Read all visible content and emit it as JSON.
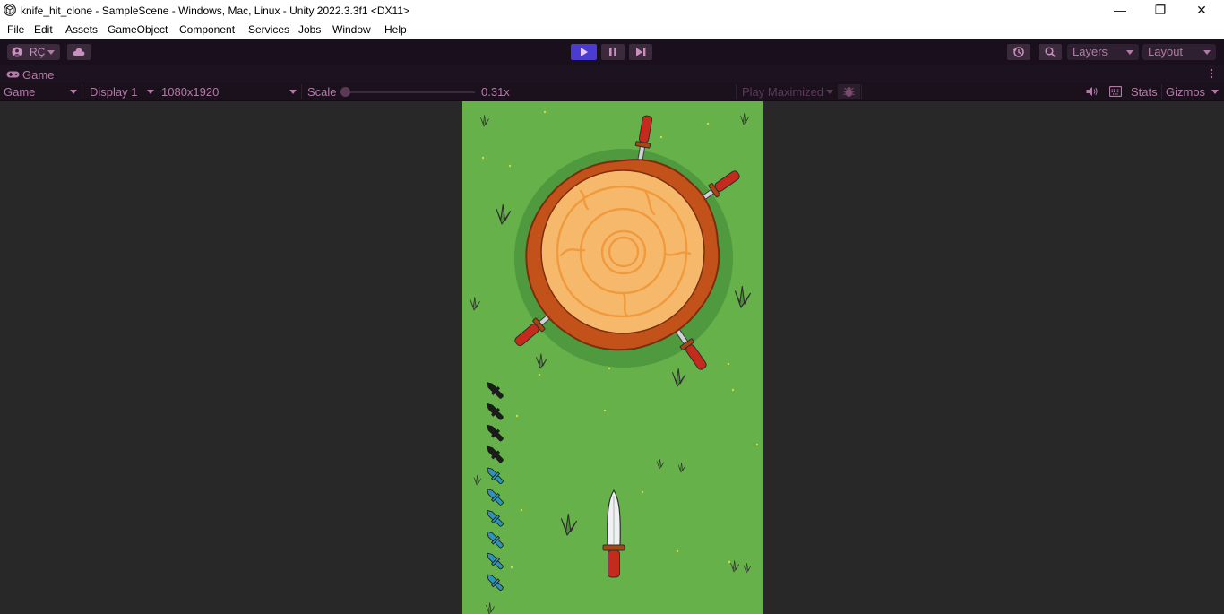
{
  "window": {
    "title": "knife_hit_clone - SampleScene - Windows, Mac, Linux - Unity 2022.3.3f1 <DX11>",
    "minimize_glyph": "—",
    "maximize_glyph": "❐",
    "close_glyph": "✕"
  },
  "menubar": {
    "items": [
      "File",
      "Edit",
      "Assets",
      "GameObject",
      "Component",
      "Services",
      "Jobs",
      "Window",
      "Help"
    ]
  },
  "toolbar": {
    "account_label": "RÇ",
    "layers_label": "Layers",
    "layout_label": "Layout",
    "play_state": "playing"
  },
  "tab": {
    "label": "Game"
  },
  "game_toolbar": {
    "view_mode": "Game",
    "display": "Display 1",
    "resolution": "1080x1920",
    "scale_label": "Scale",
    "scale_value": "0.31x",
    "scale_fraction": 0.0,
    "play_mode": "Play Maximized",
    "stats_label": "Stats",
    "gizmos_label": "Gizmos"
  },
  "game": {
    "knives_stuck_in_log": 4,
    "knives_remaining_total": 10,
    "knives_used_indicator": 4,
    "colors": {
      "background": "#67b14b",
      "log_bark": "#c2521a",
      "log_wood": "#f6b96c",
      "handle": "#c42b1c",
      "knife_icon_used": "#1c1c1c",
      "knife_icon_available": "#2e93b7"
    }
  }
}
